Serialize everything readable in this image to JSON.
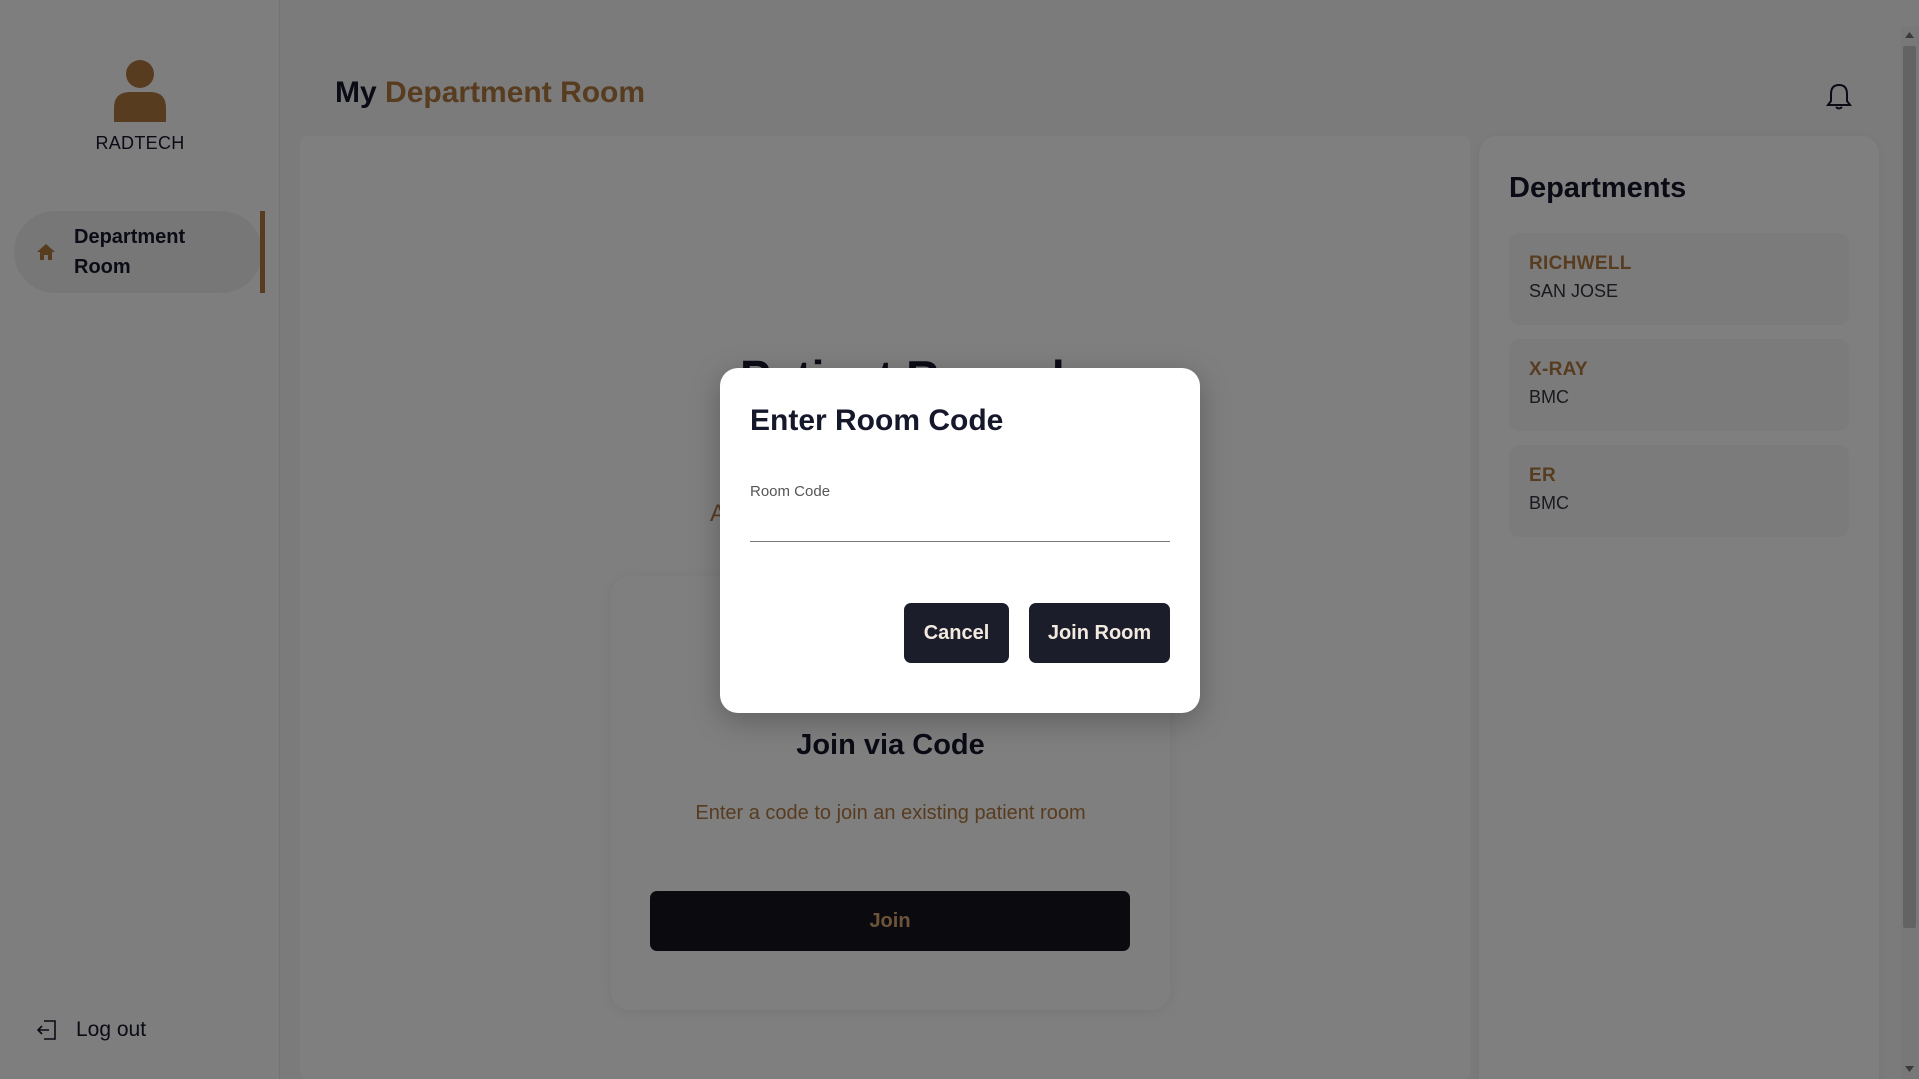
{
  "sidebar": {
    "user_name": "RADTECH",
    "nav_item_label": "Department Room",
    "logout_label": "Log out"
  },
  "header": {
    "title_prefix": "My",
    "title_accent": "Department Room"
  },
  "main": {
    "section_title": "Patient Records",
    "partial_text": "A",
    "join_card": {
      "title": "Join via Code",
      "description": "Enter a code to join an existing patient room",
      "button_label": "Join"
    }
  },
  "departments": {
    "title": "Departments",
    "items": [
      {
        "name": "RICHWELL",
        "location": "SAN JOSE"
      },
      {
        "name": "X-RAY",
        "location": "BMC"
      },
      {
        "name": "ER",
        "location": "BMC"
      }
    ]
  },
  "modal": {
    "title": "Enter Room Code",
    "field_label": "Room Code",
    "field_value": "",
    "cancel_label": "Cancel",
    "join_label": "Join Room"
  },
  "colors": {
    "accent": "#b07840",
    "dark": "#15172b",
    "button": "#1c1d2b"
  },
  "icons": [
    "user-avatar-icon",
    "home-icon",
    "logout-icon",
    "bell-icon"
  ]
}
